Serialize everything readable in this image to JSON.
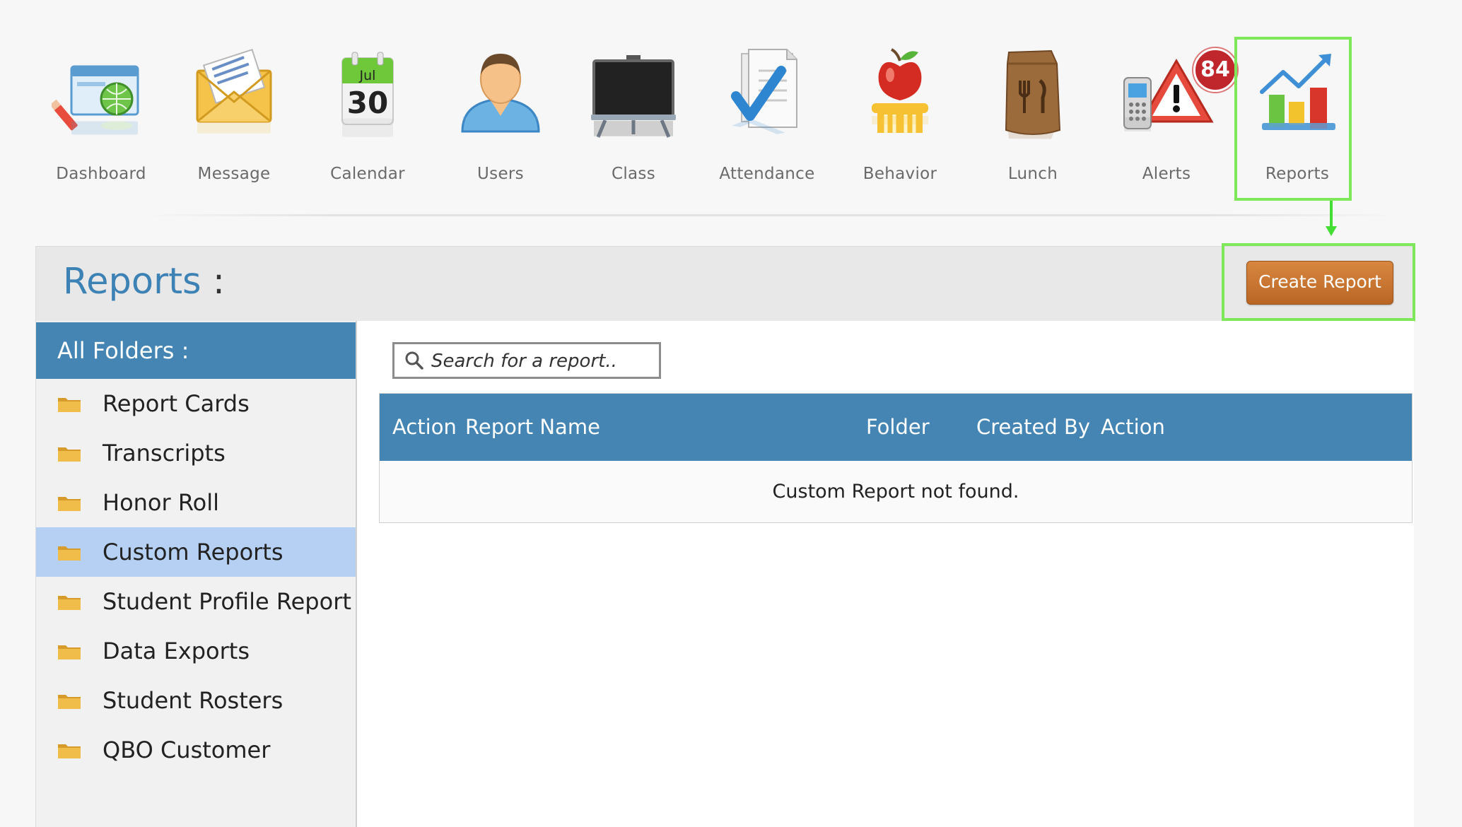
{
  "nav": {
    "items": [
      {
        "label": "Dashboard",
        "icon": "dashboard-icon"
      },
      {
        "label": "Message",
        "icon": "envelope-icon"
      },
      {
        "label": "Calendar",
        "icon": "calendar-icon",
        "month": "Jul",
        "day": "30"
      },
      {
        "label": "Users",
        "icon": "user-icon"
      },
      {
        "label": "Class",
        "icon": "chalkboard-icon"
      },
      {
        "label": "Attendance",
        "icon": "checklist-icon"
      },
      {
        "label": "Behavior",
        "icon": "apple-icon"
      },
      {
        "label": "Lunch",
        "icon": "lunch-bag-icon"
      },
      {
        "label": "Alerts",
        "icon": "alert-icon",
        "badge": "84"
      },
      {
        "label": "Reports",
        "icon": "bar-chart-icon"
      }
    ],
    "active": "Reports",
    "highlight_color": "#7ee85a"
  },
  "page": {
    "title": "Reports",
    "title_colon": ":",
    "create_button": "Create Report",
    "accent_color": "#4585b4",
    "button_color": "#c97633"
  },
  "sidebar": {
    "heading": "All Folders :",
    "folders": [
      {
        "label": "Report Cards"
      },
      {
        "label": "Transcripts"
      },
      {
        "label": "Honor Roll"
      },
      {
        "label": "Custom Reports",
        "selected": true
      },
      {
        "label": "Student Profile Report"
      },
      {
        "label": "Data Exports"
      },
      {
        "label": "Student Rosters"
      },
      {
        "label": "QBO Customer"
      }
    ]
  },
  "search": {
    "placeholder": "Search for a report..",
    "icon": "search-icon"
  },
  "table": {
    "columns": [
      "Action",
      "Report Name",
      "Folder",
      "Created By",
      "Action"
    ],
    "empty_message": "Custom Report not found."
  }
}
